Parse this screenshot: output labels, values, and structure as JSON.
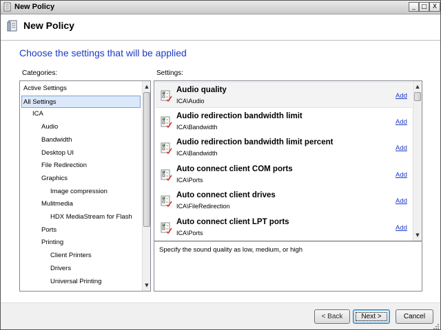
{
  "window": {
    "title": "New Policy",
    "minimize_label": "_",
    "maximize_label": "□",
    "close_label": "X"
  },
  "header": {
    "title": "New Policy"
  },
  "main": {
    "heading": "Choose the settings that will be applied",
    "categories_label": "Categories:",
    "settings_label": "Settings:",
    "description": "Specify the sound quality as low, medium, or high"
  },
  "categories": [
    {
      "label": "Active Settings",
      "level": 0,
      "selected": false
    },
    {
      "label": "All Settings",
      "level": 0,
      "selected": true
    },
    {
      "label": "ICA",
      "level": 1,
      "selected": false
    },
    {
      "label": "Audio",
      "level": 2,
      "selected": false
    },
    {
      "label": "Bandwidth",
      "level": 2,
      "selected": false
    },
    {
      "label": "Desktop UI",
      "level": 2,
      "selected": false
    },
    {
      "label": "File Redirection",
      "level": 2,
      "selected": false
    },
    {
      "label": "Graphics",
      "level": 2,
      "selected": false
    },
    {
      "label": "Image compression",
      "level": 3,
      "selected": false
    },
    {
      "label": "Mulitmedia",
      "level": 2,
      "selected": false
    },
    {
      "label": "HDX MediaStream for Flash",
      "level": 3,
      "selected": false
    },
    {
      "label": "Ports",
      "level": 2,
      "selected": false
    },
    {
      "label": "Printing",
      "level": 2,
      "selected": false
    },
    {
      "label": "Client Printers",
      "level": 3,
      "selected": false
    },
    {
      "label": "Drivers",
      "level": 3,
      "selected": false
    },
    {
      "label": "Universal Printing",
      "level": 3,
      "selected": false
    }
  ],
  "settings": [
    {
      "name": "Audio quality",
      "path": "ICA\\Audio",
      "add": "Add",
      "selected": true
    },
    {
      "name": "Audio redirection bandwidth limit",
      "path": "ICA\\Bandwidth",
      "add": "Add",
      "selected": false
    },
    {
      "name": "Audio redirection bandwidth limit percent",
      "path": "ICA\\Bandwidth",
      "add": "Add",
      "selected": false
    },
    {
      "name": "Auto connect client COM ports",
      "path": "ICA\\Ports",
      "add": "Add",
      "selected": false
    },
    {
      "name": "Auto connect client drives",
      "path": "ICA\\FileRedirection",
      "add": "Add",
      "selected": false
    },
    {
      "name": "Auto connect client LPT ports",
      "path": "ICA\\Ports",
      "add": "Add",
      "selected": false
    }
  ],
  "buttons": {
    "back": "< Back",
    "next": "Next >",
    "cancel": "Cancel"
  },
  "colors": {
    "heading_text": "#1d39c4",
    "link": "#1d39c4",
    "selection_bg": "#dbe8f9"
  }
}
